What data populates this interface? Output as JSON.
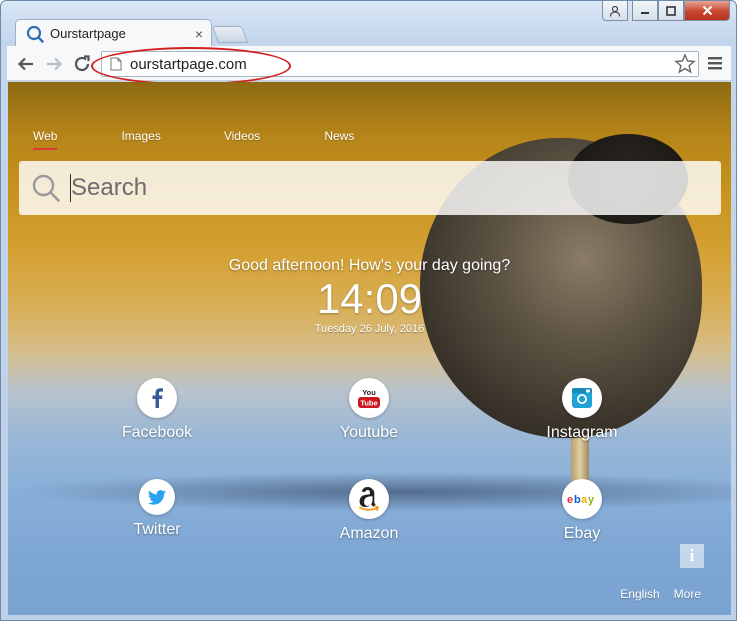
{
  "browser": {
    "tab_title": "Ourstartpage",
    "tab_close": "×",
    "url": "ourstartpage.com"
  },
  "nav": [
    "Web",
    "Images",
    "Videos",
    "News"
  ],
  "search": {
    "placeholder": "Search"
  },
  "greeting": "Good afternoon! How's your day going?",
  "clock": {
    "time": "14:09",
    "date": "Tuesday 26 July, 2016"
  },
  "tiles": [
    {
      "label": "Facebook",
      "icon": "facebook-icon",
      "color": "#3b5998"
    },
    {
      "label": "Youtube",
      "icon": "youtube-icon",
      "color": "#cc181e"
    },
    {
      "label": "Instagram",
      "icon": "instagram-icon",
      "color": "#1fa3d6"
    },
    {
      "label": "Twitter",
      "icon": "twitter-icon",
      "color": "#2aa3ef"
    },
    {
      "label": "Amazon",
      "icon": "amazon-icon",
      "color": "#222222"
    },
    {
      "label": "Ebay",
      "icon": "ebay-icon",
      "color": "#e53238"
    }
  ],
  "youtube_logo": {
    "line1": "You",
    "line2": "Tube"
  },
  "ebay_logo": [
    "e",
    "b",
    "a",
    "y"
  ],
  "info_label": "i",
  "footer": {
    "language": "English",
    "more": "More"
  },
  "colors": {
    "active_underline": "#e0373d",
    "annotation_ring": "#d21f1f"
  }
}
